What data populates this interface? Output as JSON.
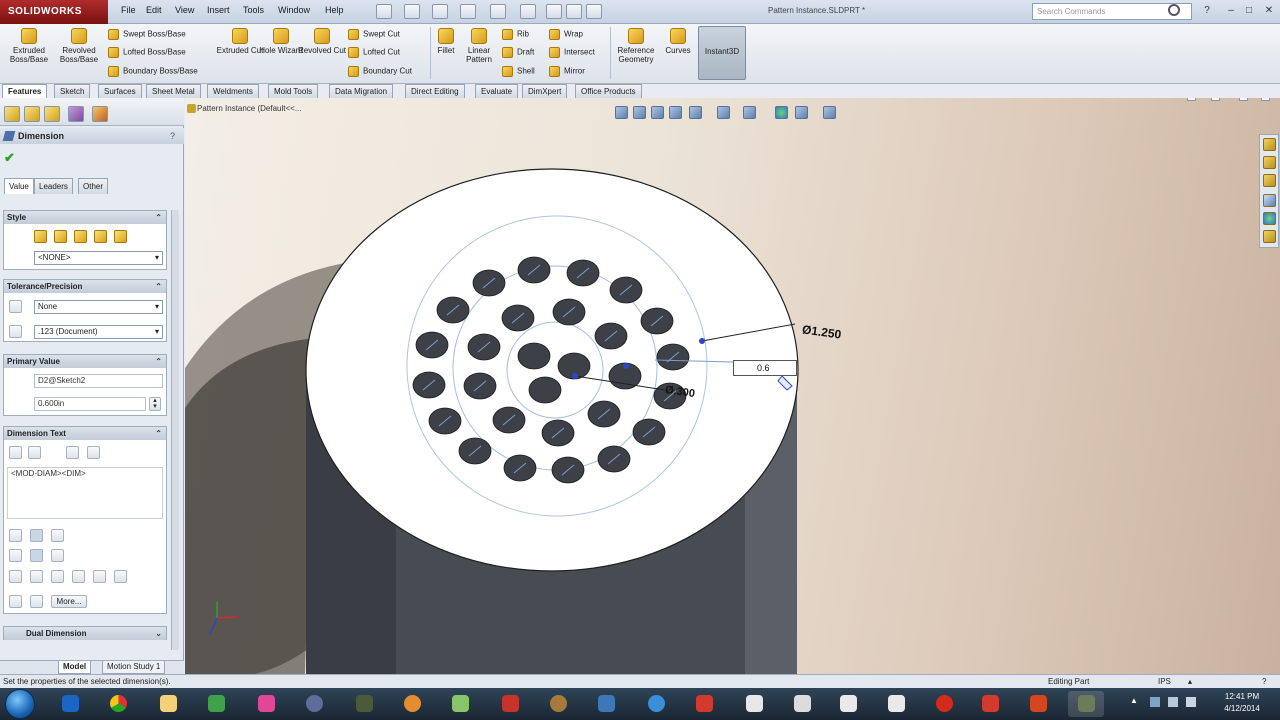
{
  "app": {
    "logo_text": "SOLIDWORKS",
    "document_title": "Pattern Instance.SLDPRT *",
    "menu": [
      "File",
      "Edit",
      "View",
      "Insert",
      "Tools",
      "Window",
      "Help"
    ],
    "search_placeholder": "Search Commands"
  },
  "commands": {
    "extruded_boss": "Extruded Boss/Base",
    "revolved_boss": "Revolved Boss/Base",
    "swept_boss": "Swept Boss/Base",
    "lofted_boss": "Lofted Boss/Base",
    "boundary_boss": "Boundary Boss/Base",
    "extruded_cut": "Extruded Cut",
    "hole_wizard": "Hole Wizard",
    "revolved_cut": "Revolved Cut",
    "swept_cut": "Swept Cut",
    "lofted_cut": "Lofted Cut",
    "boundary_cut": "Boundary Cut",
    "fillet": "Fillet",
    "linear_pattern": "Linear Pattern",
    "rib": "Rib",
    "draft": "Draft",
    "shell": "Shell",
    "wrap": "Wrap",
    "intersect": "Intersect",
    "mirror": "Mirror",
    "reference_geometry": "Reference Geometry",
    "curves": "Curves",
    "instant3d": "Instant3D"
  },
  "tabs": [
    "Features",
    "Sketch",
    "Surfaces",
    "Sheet Metal",
    "Weldments",
    "Mold Tools",
    "Data Migration",
    "Direct Editing",
    "Evaluate",
    "DimXpert",
    "Office Products"
  ],
  "property_manager": {
    "title": "Dimension",
    "help": "?",
    "tabs": [
      "Value",
      "Leaders",
      "Other"
    ],
    "style": {
      "header": "Style",
      "select": "<NONE>"
    },
    "tolerance": {
      "header": "Tolerance/Precision",
      "type": "None",
      "precision": ".123 (Document)"
    },
    "primary_value": {
      "header": "Primary Value",
      "name": "D2@Sketch2",
      "value": "0.600in"
    },
    "dimension_text": {
      "header": "Dimension Text",
      "text": "<MOD-DIAM><DIM>",
      "more_label": "More..."
    },
    "dual_dimension": {
      "header": "Dual Dimension"
    }
  },
  "model_tabs": [
    "Model",
    "Motion Study 1"
  ],
  "viewport": {
    "tree_label": "Pattern Instance  (Default<<..."
  },
  "annotations": {
    "outer_diameter": "Ø1.250",
    "inner_diameter": "Ø.300",
    "edit_value": "0.6"
  },
  "status": {
    "message": "Set the properties of the selected dimension(s).",
    "mode": "Editing Part",
    "units": "IPS"
  },
  "clock": {
    "time": "12:41 PM",
    "date": "4/12/2014"
  }
}
